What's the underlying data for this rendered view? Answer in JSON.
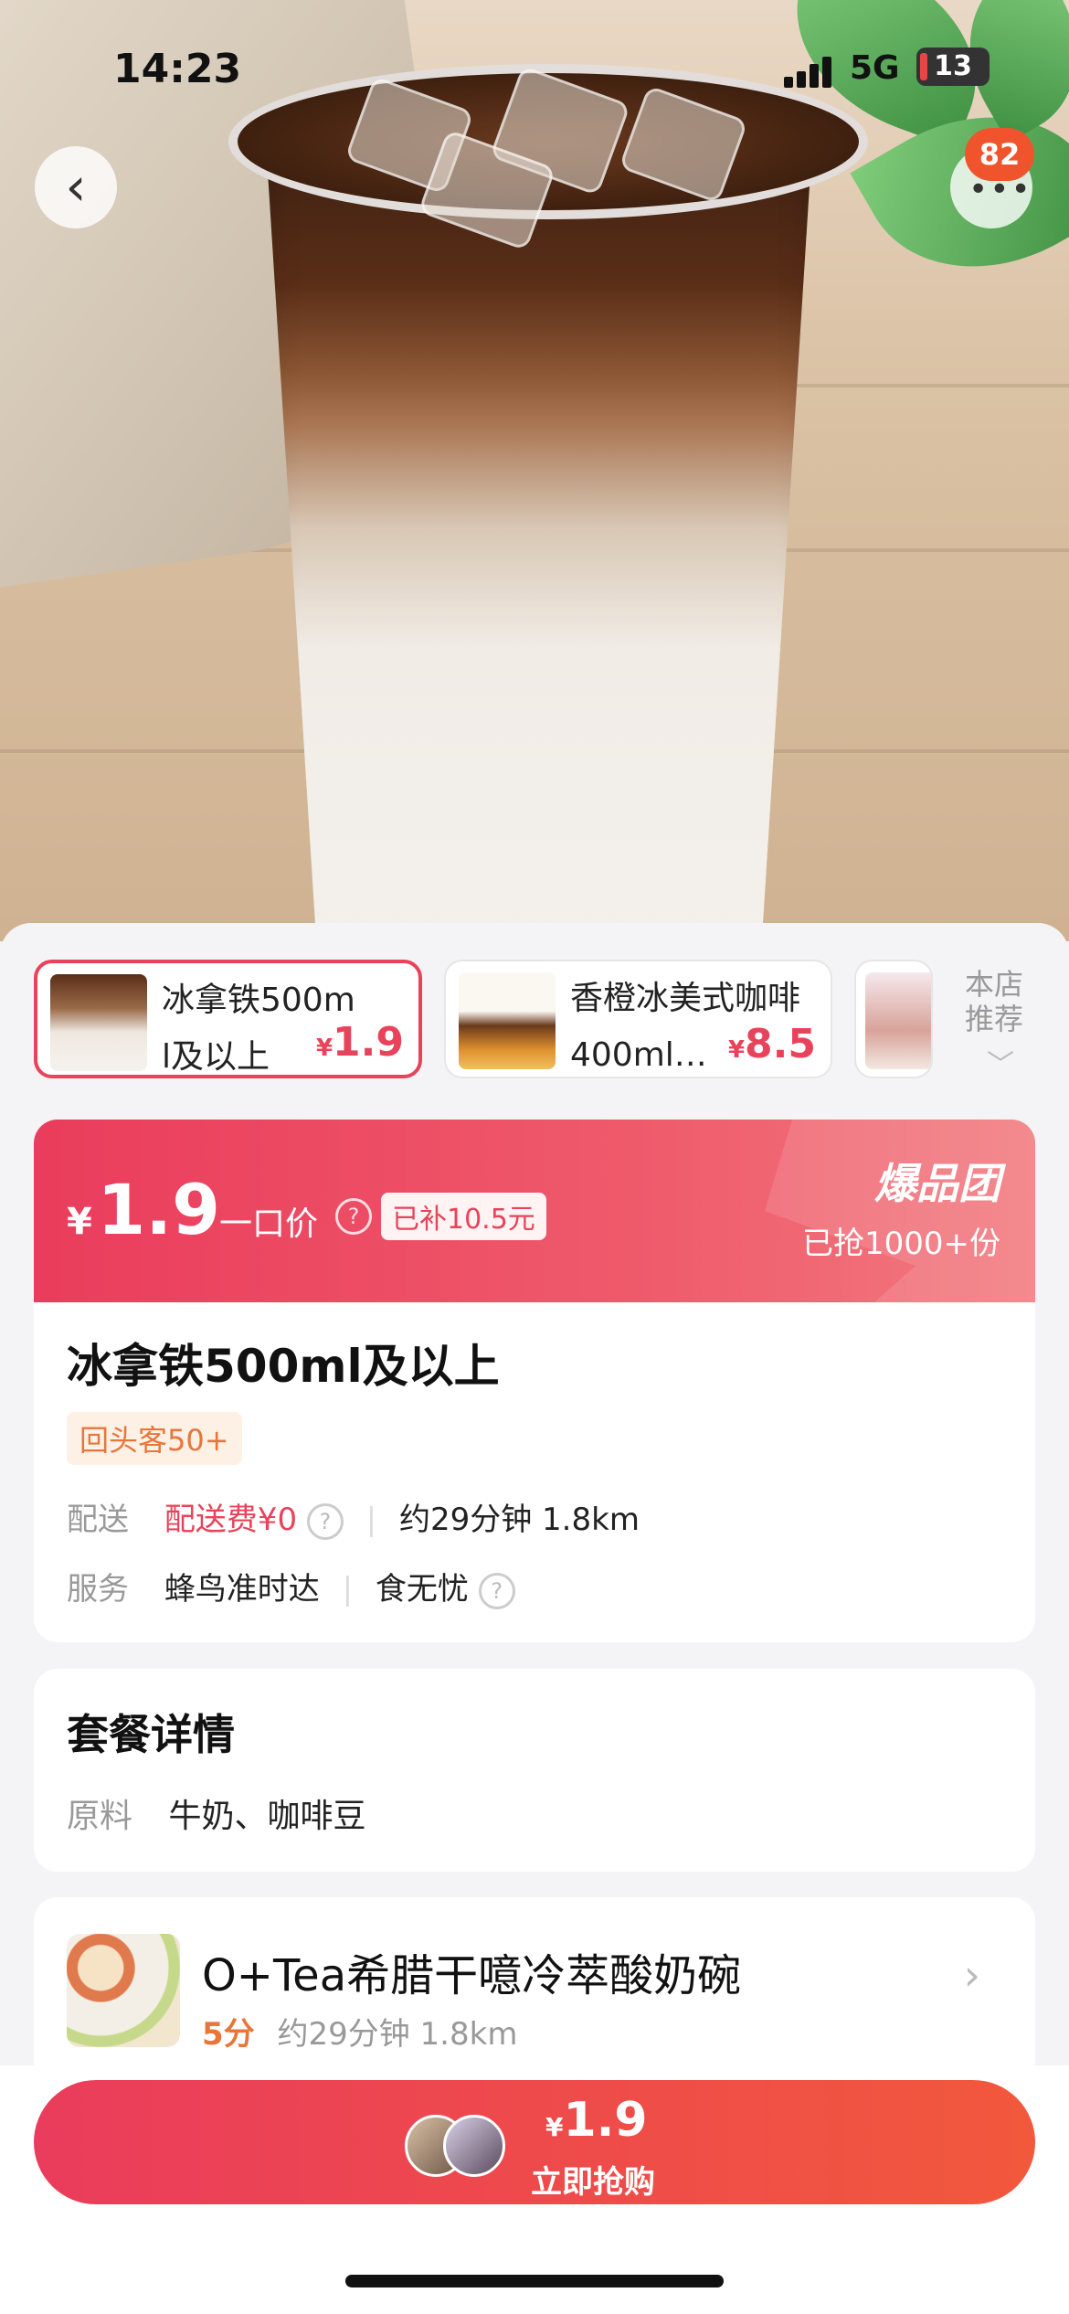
{
  "status_bar": {
    "time": "14:23",
    "network": "5G",
    "battery": "13"
  },
  "header": {
    "back_icon": "chevron-left-icon",
    "more_icon": "more-dots-icon",
    "badge_count": "82"
  },
  "product_tabs": [
    {
      "title": "冰拿铁500m\nl及以上",
      "price_symbol": "¥",
      "price": "1.9",
      "active": true
    },
    {
      "title": "香橙冰美式咖啡\n400ml…",
      "price_symbol": "¥",
      "price": "8.5",
      "active": false
    }
  ],
  "recommend_label": "本店\n推荐",
  "deal": {
    "price_symbol": "¥",
    "price": "1.9",
    "price_label": "一口价",
    "subsidy": "已补10.5元",
    "brand": "爆品团",
    "sold": "已抢1000+份"
  },
  "product": {
    "name": "冰拿铁500ml及以上",
    "returning_badge": "回头客50+",
    "delivery_label": "配送",
    "delivery_fee": "配送费¥0",
    "delivery_eta": "约29分钟 1.8km",
    "service_label": "服务",
    "service_1": "蜂鸟准时达",
    "service_2": "食无忧"
  },
  "package": {
    "title": "套餐详情",
    "ingredients_label": "原料",
    "ingredients": "牛奶、咖啡豆"
  },
  "shop": {
    "name": "O+Tea希腊干噫冷萃酸奶碗",
    "score": "5分",
    "eta": "约29分钟 1.8km"
  },
  "buy": {
    "price_symbol": "¥",
    "price": "1.9",
    "label": "立即抢购"
  },
  "colors": {
    "accent": "#e8435a",
    "orange": "#e8763a"
  }
}
